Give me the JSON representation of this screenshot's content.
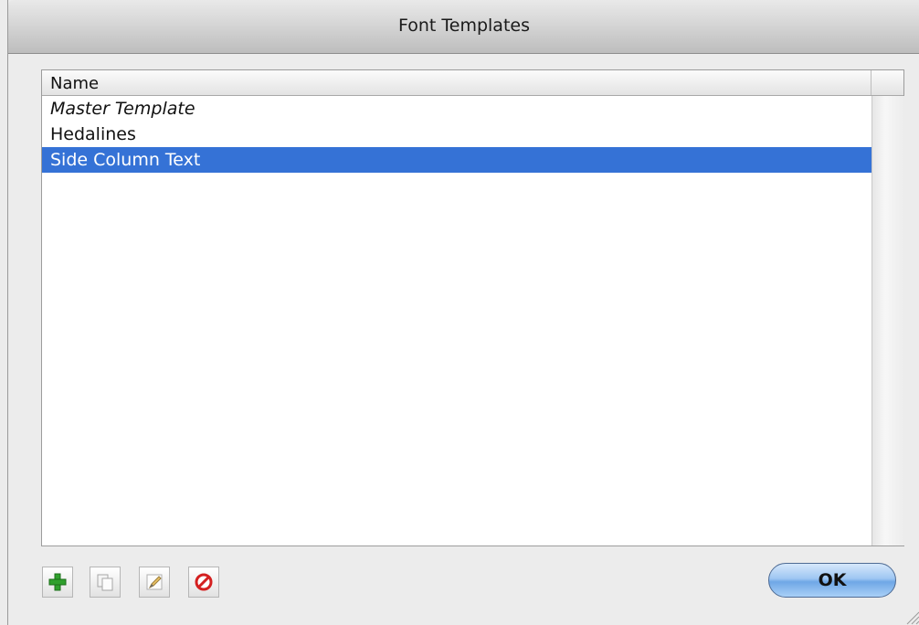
{
  "window": {
    "title": "Font Templates"
  },
  "table": {
    "header": "Name",
    "rows": [
      {
        "label": "Master Template",
        "italic": true,
        "selected": false
      },
      {
        "label": "Hedalines",
        "italic": false,
        "selected": false
      },
      {
        "label": "Side Column Text",
        "italic": false,
        "selected": true
      }
    ]
  },
  "toolbar": {
    "buttons": [
      {
        "icon": "add-icon"
      },
      {
        "icon": "duplicate-icon"
      },
      {
        "icon": "edit-icon"
      },
      {
        "icon": "delete-icon"
      }
    ]
  },
  "footer": {
    "ok_label": "OK"
  },
  "colors": {
    "selection": "#3572d6",
    "ok_button": "#9ec6f2"
  }
}
